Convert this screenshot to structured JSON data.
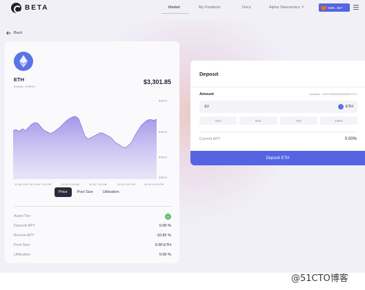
{
  "header": {
    "logo_text": "BETA",
    "nav": [
      {
        "label": "Market",
        "active": true
      },
      {
        "label": "My Positions",
        "active": false
      },
      {
        "label": "Docs",
        "active": false
      },
      {
        "label": "Alpha Tokenomics ↗",
        "active": false
      }
    ],
    "wallet_label": "0x86...6E7"
  },
  "back_label": "Back",
  "asset": {
    "name": "ETH",
    "subtitle": "0x4b3a...57f9b14",
    "price": "$3,301.85"
  },
  "chart_data": {
    "type": "area",
    "color": "#9a8ae6",
    "y_tick_labels": [
      "$SE00",
      "$SE00",
      "$SE00",
      "$SE00"
    ],
    "x_tick_labels": [
      "10-08 1:00 PM",
      "10-08 7:00 PM",
      "10-09 1:00 AM",
      "10-09 7:00 AM",
      "10-09 1:00 PM",
      "10-09 10:00 PM"
    ],
    "values": [
      62,
      63,
      61,
      64,
      62,
      66,
      70,
      72,
      71,
      66,
      62,
      60,
      58,
      60,
      63,
      66,
      70,
      74,
      77,
      79,
      80,
      77,
      66,
      55,
      51,
      53,
      55,
      57,
      59,
      58,
      56,
      54,
      50,
      46,
      44,
      41,
      40,
      43,
      47,
      55,
      62,
      68,
      72,
      75,
      76,
      75,
      76
    ]
  },
  "chart_tabs": [
    {
      "label": "Price",
      "active": true
    },
    {
      "label": "Pool Size",
      "active": false
    },
    {
      "label": "Utilization",
      "active": false
    }
  ],
  "stats": [
    {
      "label": "Asset Tier",
      "value": "",
      "badge": "01"
    },
    {
      "label": "Deposit APY",
      "value": "0.00 %"
    },
    {
      "label": "Borrow APY",
      "value": "-10.82 %"
    },
    {
      "label": "Pool Size",
      "value": "0.00 ETH"
    },
    {
      "label": "Utilization",
      "value": "0.00 %"
    }
  ],
  "deposit": {
    "title": "Deposit",
    "amount_label": "Amount",
    "available": "Available - 1000.000000000000000 ETH",
    "input_value": "10",
    "unit": "ETH",
    "percent_options": [
      "10%",
      "50%",
      "75%",
      "100%"
    ],
    "apy_label": "Current APY",
    "apy_value": "0.00%",
    "button_label": "Deposit ETH"
  },
  "watermark": "@51CTO博客",
  "colors": {
    "accent": "#5464e2",
    "eth": "#5a74e6",
    "chart_fill": "#9a8ae6"
  }
}
